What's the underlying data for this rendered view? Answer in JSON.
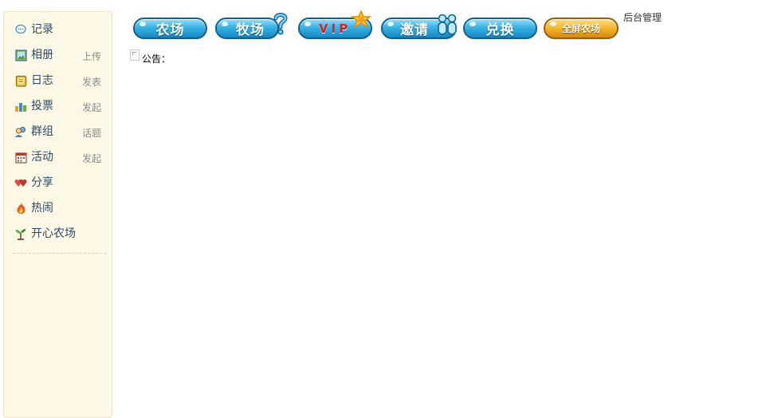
{
  "sidebar": {
    "items": [
      {
        "label": "记录",
        "action": "",
        "icon": "speech-bubble-icon"
      },
      {
        "label": "相册",
        "action": "上传",
        "icon": "photo-frame-icon"
      },
      {
        "label": "日志",
        "action": "发表",
        "icon": "notepad-icon"
      },
      {
        "label": "投票",
        "action": "发起",
        "icon": "bar-chart-icon"
      },
      {
        "label": "群组",
        "action": "话题",
        "icon": "people-icon"
      },
      {
        "label": "活动",
        "action": "发起",
        "icon": "calendar-icon"
      },
      {
        "label": "分享",
        "action": "",
        "icon": "hearts-icon"
      },
      {
        "label": "热闹",
        "action": "",
        "icon": "fire-icon"
      },
      {
        "label": "开心农场",
        "action": "",
        "icon": "sprout-icon"
      }
    ]
  },
  "topnav": {
    "buttons": [
      {
        "label": "农场"
      },
      {
        "label": "牧场"
      },
      {
        "label": "VIP"
      },
      {
        "label": "邀请"
      },
      {
        "label": "兑换"
      },
      {
        "label": "全屏农场"
      }
    ],
    "admin_label": "后台管理"
  },
  "notice": {
    "label": "公告："
  },
  "colors": {
    "sidebar_bg": "#fdf9e6",
    "pill_blue": "#39b3e6",
    "pill_gold": "#f3b52c",
    "link": "#2b4a6b"
  }
}
